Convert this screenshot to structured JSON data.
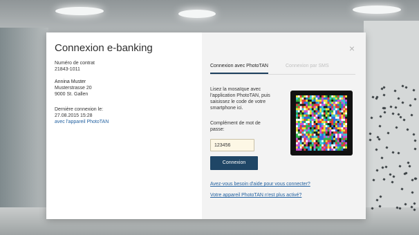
{
  "dialog": {
    "title": "Connexion e-banking",
    "contract_label": "Numéro de contrat",
    "contract_number": "21843-1011",
    "customer": {
      "name": "Annina Muster",
      "street": "Musterstrasse 20",
      "city": "9000 St. Gallen"
    },
    "last_login_label": "Dernière connexion le:",
    "last_login_time": "27.08.2015 15:28",
    "last_login_device": "avec l'appareil PhotoTAN",
    "close_icon": "×"
  },
  "tabs": [
    {
      "label": "Connexion avec PhotoTAN",
      "active": true
    },
    {
      "label": "Connexion par SMS",
      "active": false
    }
  ],
  "phototan": {
    "instruction": "Lisez la mosaïque avec l'application PhotoTAN, puis saisissez le code de votre smartphone ici.",
    "password_label": "Complément de mot de passe:",
    "password_value": "123456",
    "submit_label": "Connexion",
    "help_link": "Avez-vous besoin d'aide pour vous connecter?",
    "device_link": "Votre appareil PhotoTAN n'est plus activé?"
  },
  "colors": {
    "accent": "#1f4666",
    "link": "#1f5f9f",
    "input_bg": "#fdf7e5"
  }
}
